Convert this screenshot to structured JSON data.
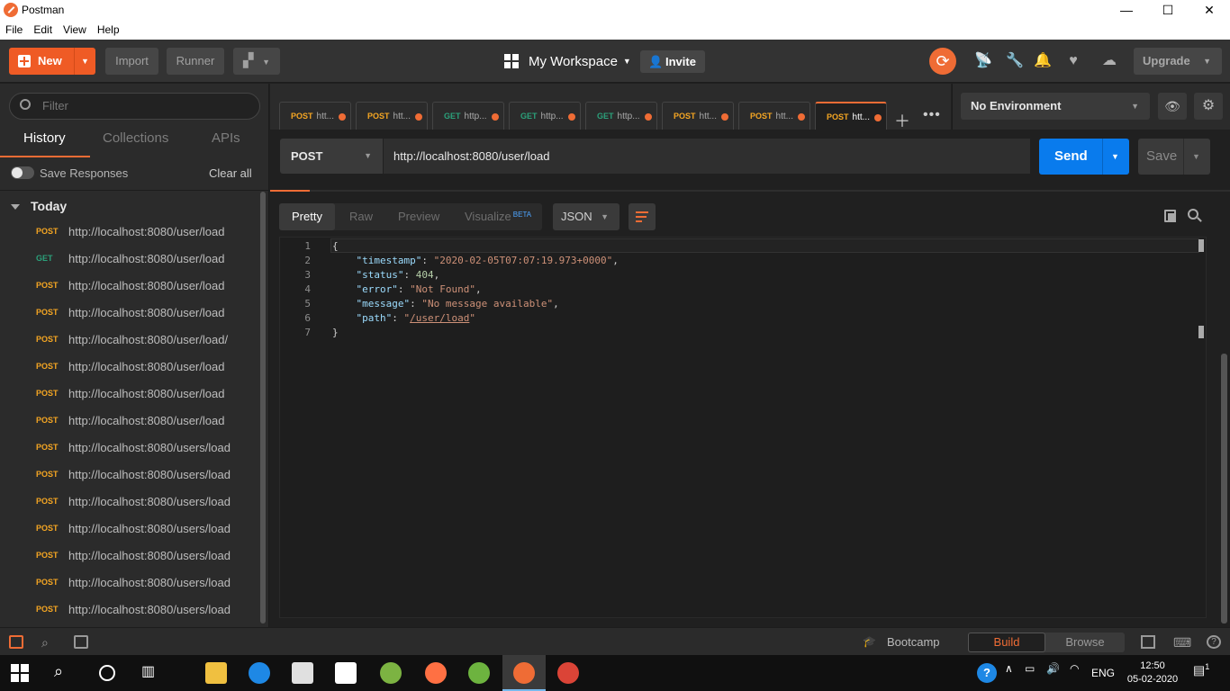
{
  "window": {
    "title": "Postman",
    "minimize": "—",
    "maximize": "☐",
    "close": "✕"
  },
  "menu": [
    "File",
    "Edit",
    "View",
    "Help"
  ],
  "header": {
    "new_label": "New",
    "import_label": "Import",
    "runner_label": "Runner",
    "workspace_label": "My Workspace",
    "invite_label": "Invite",
    "upgrade_label": "Upgrade"
  },
  "sidebar": {
    "filter_placeholder": "Filter",
    "tabs": [
      "History",
      "Collections",
      "APIs"
    ],
    "save_responses_label": "Save Responses",
    "clear_all_label": "Clear all",
    "group_label": "Today",
    "items": [
      {
        "method": "POST",
        "url": "http://localhost:8080/user/load"
      },
      {
        "method": "GET",
        "url": "http://localhost:8080/user/load"
      },
      {
        "method": "POST",
        "url": "http://localhost:8080/user/load"
      },
      {
        "method": "POST",
        "url": "http://localhost:8080/user/load"
      },
      {
        "method": "POST",
        "url": "http://localhost:8080/user/load/"
      },
      {
        "method": "POST",
        "url": "http://localhost:8080/user/load"
      },
      {
        "method": "POST",
        "url": "http://localhost:8080/user/load"
      },
      {
        "method": "POST",
        "url": "http://localhost:8080/user/load"
      },
      {
        "method": "POST",
        "url": "http://localhost:8080/users/load"
      },
      {
        "method": "POST",
        "url": "http://localhost:8080/users/load"
      },
      {
        "method": "POST",
        "url": "http://localhost:8080/users/load"
      },
      {
        "method": "POST",
        "url": "http://localhost:8080/users/load"
      },
      {
        "method": "POST",
        "url": "http://localhost:8080/users/load"
      },
      {
        "method": "POST",
        "url": "http://localhost:8080/users/load"
      },
      {
        "method": "POST",
        "url": "http://localhost:8080/users/load"
      }
    ]
  },
  "request_tabs": [
    {
      "method": "POST",
      "label": "htt..."
    },
    {
      "method": "POST",
      "label": "htt..."
    },
    {
      "method": "GET",
      "label": "http..."
    },
    {
      "method": "GET",
      "label": "http..."
    },
    {
      "method": "GET",
      "label": "http..."
    },
    {
      "method": "POST",
      "label": "htt..."
    },
    {
      "method": "POST",
      "label": "htt..."
    },
    {
      "method": "POST",
      "label": "htt..."
    }
  ],
  "environment": {
    "selected": "No Environment"
  },
  "request": {
    "method": "POST",
    "url": "http://localhost:8080/user/load",
    "send_label": "Send",
    "save_label": "Save"
  },
  "response": {
    "view_tabs": [
      "Pretty",
      "Raw",
      "Preview",
      "Visualize"
    ],
    "beta_label": "BETA",
    "format": "JSON",
    "body": {
      "timestamp": "2020-02-05T07:07:19.973+0000",
      "status": "404",
      "error": "Not Found",
      "message": "No message available",
      "path": "/user/load"
    },
    "line_numbers": [
      "1",
      "2",
      "3",
      "4",
      "5",
      "6",
      "7"
    ]
  },
  "statusbar": {
    "bootcamp_label": "Bootcamp",
    "build_label": "Build",
    "browse_label": "Browse"
  },
  "taskbar": {
    "lang": "ENG",
    "time": "12:50",
    "date": "05-02-2020",
    "notification_count": "1"
  },
  "colors": {
    "accent": "#ef6c35",
    "send": "#097bed",
    "post": "#f5a623",
    "get": "#2ba07a"
  }
}
